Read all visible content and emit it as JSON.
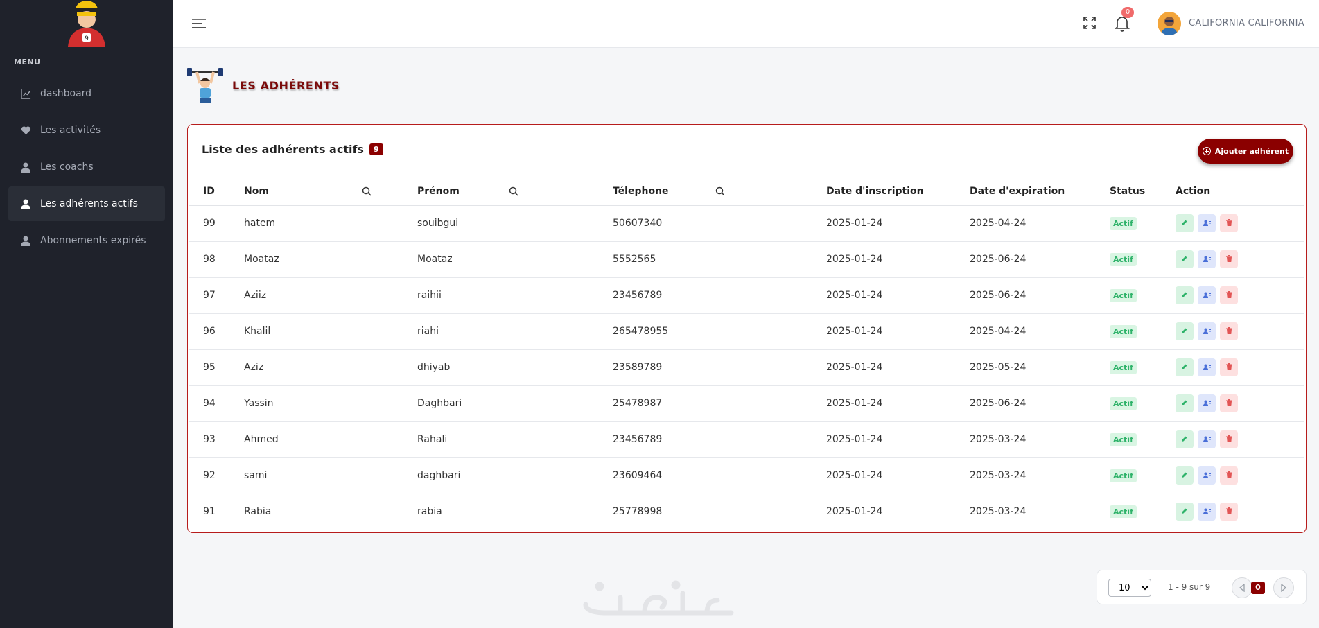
{
  "sidebar": {
    "menu_title": "MENU",
    "items": [
      {
        "label": "dashboard",
        "icon": "chart-line-icon"
      },
      {
        "label": "Les activités",
        "icon": "heart-icon"
      },
      {
        "label": "Les coachs",
        "icon": "user-icon"
      },
      {
        "label": "Les adhérents actifs",
        "icon": "user-icon",
        "active": true
      },
      {
        "label": "Abonnements expirés",
        "icon": "user-icon"
      }
    ]
  },
  "header": {
    "notification_count": "0",
    "user_name": "CALIFORNIA CALIFORNIA"
  },
  "page": {
    "title": "LES ADHÉRENTS"
  },
  "card": {
    "title": "Liste des adhérents actifs",
    "count": "9",
    "add_button": "Ajouter adhérent"
  },
  "table": {
    "columns": [
      "ID",
      "Nom",
      "Prénom",
      "Télephone",
      "Date d'inscription",
      "Date d'expiration",
      "Status",
      "Action"
    ],
    "rows": [
      {
        "id": "99",
        "nom": "hatem",
        "prenom": "souibgui",
        "tel": "50607340",
        "inscription": "2025-01-24",
        "expiration": "2025-04-24",
        "status": "Actif"
      },
      {
        "id": "98",
        "nom": "Moataz",
        "prenom": "Moataz",
        "tel": "5552565",
        "inscription": "2025-01-24",
        "expiration": "2025-06-24",
        "status": "Actif"
      },
      {
        "id": "97",
        "nom": "Aziiz",
        "prenom": "raihii",
        "tel": "23456789",
        "inscription": "2025-01-24",
        "expiration": "2025-06-24",
        "status": "Actif"
      },
      {
        "id": "96",
        "nom": "Khalil",
        "prenom": "riahi",
        "tel": "265478955",
        "inscription": "2025-01-24",
        "expiration": "2025-04-24",
        "status": "Actif"
      },
      {
        "id": "95",
        "nom": "Aziz",
        "prenom": "dhiyab",
        "tel": "23589789",
        "inscription": "2025-01-24",
        "expiration": "2025-05-24",
        "status": "Actif"
      },
      {
        "id": "94",
        "nom": "Yassin",
        "prenom": "Daghbari",
        "tel": "25478987",
        "inscription": "2025-01-24",
        "expiration": "2025-06-24",
        "status": "Actif"
      },
      {
        "id": "93",
        "nom": "Ahmed",
        "prenom": "Rahali",
        "tel": "23456789",
        "inscription": "2025-01-24",
        "expiration": "2025-03-24",
        "status": "Actif"
      },
      {
        "id": "92",
        "nom": "sami",
        "prenom": "daghbari",
        "tel": "23609464",
        "inscription": "2025-01-24",
        "expiration": "2025-03-24",
        "status": "Actif"
      },
      {
        "id": "91",
        "nom": "Rabia",
        "prenom": "rabia",
        "tel": "25778998",
        "inscription": "2025-01-24",
        "expiration": "2025-03-24",
        "status": "Actif"
      }
    ]
  },
  "pagination": {
    "page_size": "10",
    "page_size_options": [
      "10"
    ],
    "range": "1 - 9 sur 9",
    "current_page": "0"
  },
  "colors": {
    "sidebar_bg": "#1f222b",
    "accent": "#8b0000",
    "status_green": "#2fb36a"
  }
}
